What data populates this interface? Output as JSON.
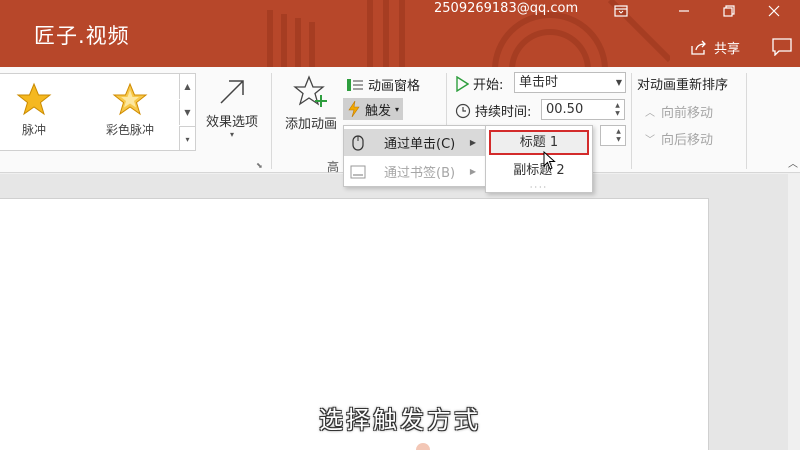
{
  "app": {
    "logo_text": "匠子.视频",
    "account": "2509269183@qq.com"
  },
  "titlebar_actions": {
    "share_label": "共享"
  },
  "colors": {
    "titlebar": "#b7472a",
    "highlight_border": "#d32b2b",
    "menu_hover": "#d9d9d9",
    "star": "#f5b820"
  },
  "ribbon": {
    "gallery": [
      {
        "label": "脉冲",
        "icon": "star-icon"
      },
      {
        "label": "彩色脉冲",
        "icon": "star-icon"
      }
    ],
    "effect_options": {
      "label": "效果选项"
    },
    "add_animation": {
      "label": "添加动画"
    },
    "animation_pane": {
      "label": "动画窗格"
    },
    "trigger": {
      "label": "触发"
    },
    "advanced_group_label": "高",
    "start": {
      "label": "开始:",
      "value": "单击时"
    },
    "duration": {
      "label": "持续时间:",
      "value": "00.50"
    },
    "reorder": {
      "title": "对动画重新排序",
      "move_earlier": "向前移动",
      "move_later": "向后移动"
    }
  },
  "trigger_menu": {
    "items": [
      {
        "label": "通过单击(C)",
        "icon": "mouse-icon",
        "enabled": true,
        "highlighted": true
      },
      {
        "label": "通过书签(B)",
        "icon": "bookmark-icon",
        "enabled": false,
        "highlighted": false
      }
    ]
  },
  "submenu": {
    "items": [
      {
        "label": "标题 1",
        "selected": true
      },
      {
        "label": "副标题 2",
        "selected": false
      }
    ]
  },
  "caption": "选择触发方式"
}
